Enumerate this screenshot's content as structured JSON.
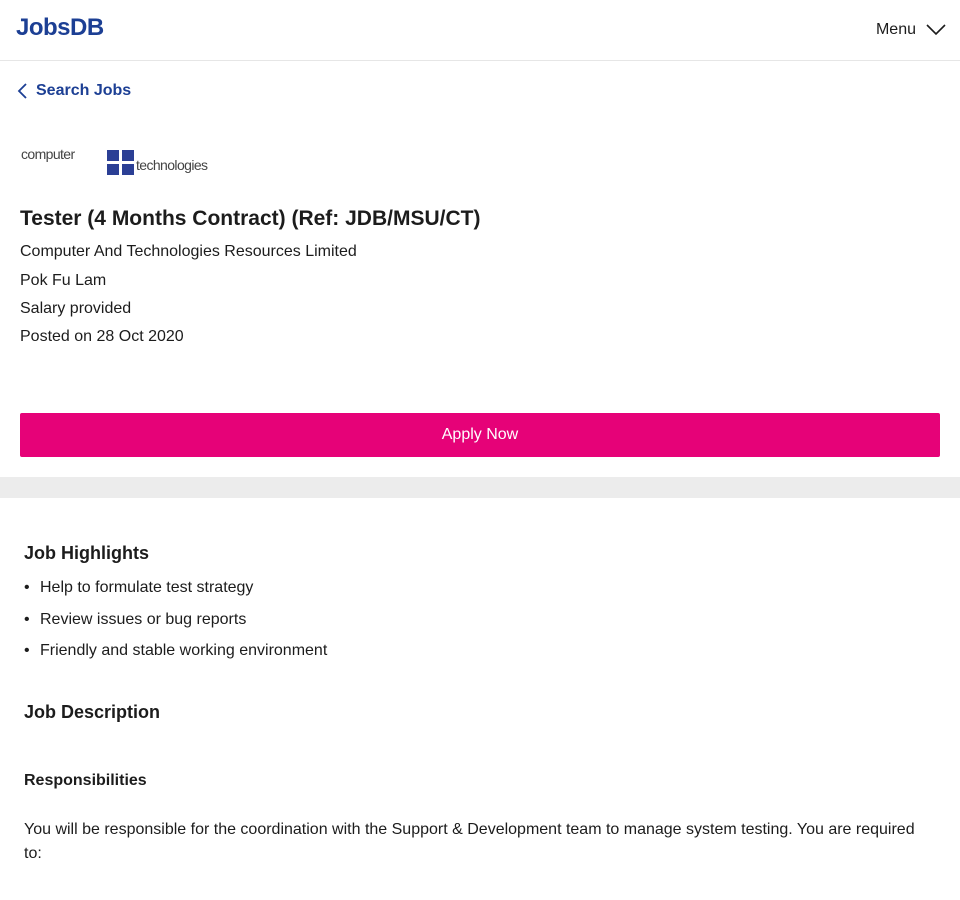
{
  "header": {
    "logo_text": "JobsDB",
    "menu_label": "Menu",
    "logo_color": "#1c3f94"
  },
  "nav": {
    "back_label": "Search Jobs",
    "back_icon": "chevron-left-icon"
  },
  "company_logo": {
    "left_word": "computer",
    "right_word": "technologies"
  },
  "job": {
    "title": "Tester (4 Months Contract) (Ref: JDB/MSU/CT)",
    "company": "Computer And Technologies Resources Limited",
    "location": "Pok Fu Lam",
    "salary": "Salary provided",
    "posted": "Posted on 28 Oct 2020"
  },
  "apply": {
    "label": "Apply Now",
    "color": "#e60278"
  },
  "highlights": {
    "heading": "Job Highlights",
    "items": [
      "Help to formulate test strategy",
      "Review issues or bug reports",
      "Friendly and stable working environment"
    ]
  },
  "description": {
    "heading": "Job Description",
    "responsibilities_heading": "Responsibilities",
    "intro": "You will be responsible for the coordination with the Support & Development team to manage system testing. You are required to:"
  }
}
